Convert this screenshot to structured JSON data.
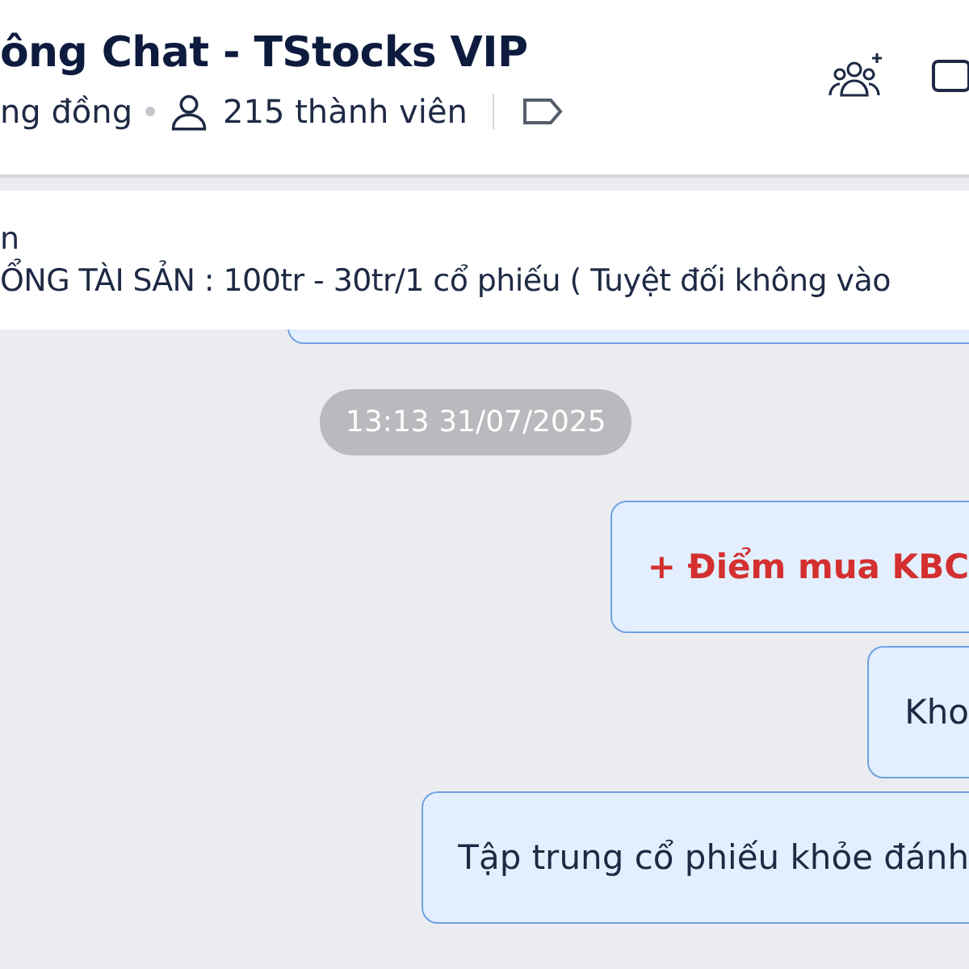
{
  "header": {
    "title": "ông Chat - TStocks VIP",
    "community": "ng đồng",
    "members": "215 thành viên"
  },
  "pinned": {
    "lines": [
      "n",
      "ỔNG TÀI SẢN : 100tr - 30tr/1 cổ phiếu ( Tuyệt đối không vào"
    ]
  },
  "timestamp": "13:13 31/07/2025",
  "messages": [
    {
      "kind": "highlight",
      "text": "+ Điểm mua KBC"
    },
    {
      "kind": "text",
      "text": "Kho"
    },
    {
      "kind": "text",
      "text": "Tập trung cổ phiếu khỏe đánh"
    }
  ]
}
